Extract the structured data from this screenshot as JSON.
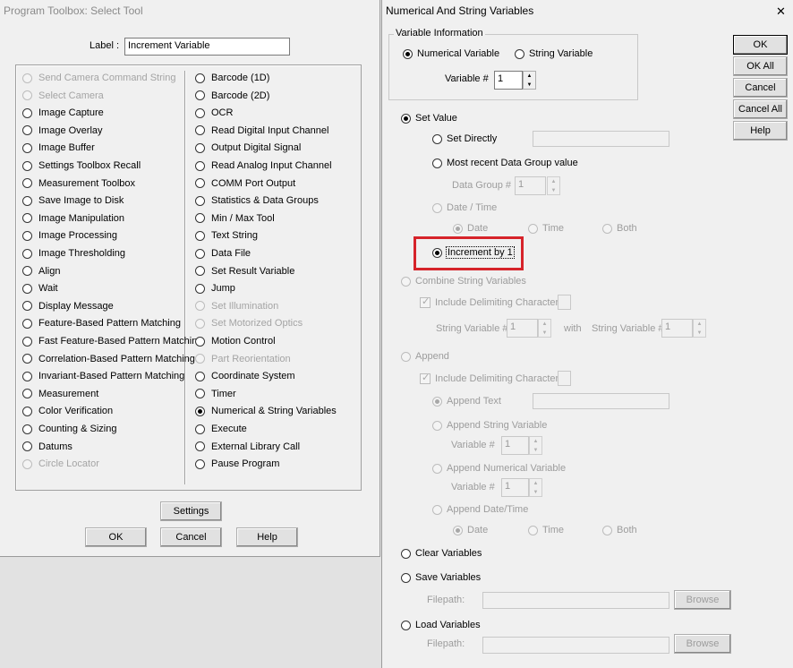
{
  "left_window": {
    "title": "Program Toolbox: Select Tool",
    "label_caption": "Label :",
    "label_value": "Increment Variable",
    "tools_col1": [
      {
        "label": "Send Camera Command String",
        "enabled": false,
        "selected": false
      },
      {
        "label": "Select Camera",
        "enabled": false,
        "selected": false
      },
      {
        "label": "Image Capture",
        "enabled": true,
        "selected": false
      },
      {
        "label": "Image Overlay",
        "enabled": true,
        "selected": false
      },
      {
        "label": "Image Buffer",
        "enabled": true,
        "selected": false
      },
      {
        "label": "Settings Toolbox Recall",
        "enabled": true,
        "selected": false
      },
      {
        "label": "Measurement Toolbox",
        "enabled": true,
        "selected": false
      },
      {
        "label": "Save Image to Disk",
        "enabled": true,
        "selected": false
      },
      {
        "label": "Image Manipulation",
        "enabled": true,
        "selected": false
      },
      {
        "label": "Image Processing",
        "enabled": true,
        "selected": false
      },
      {
        "label": "Image Thresholding",
        "enabled": true,
        "selected": false
      },
      {
        "label": "Align",
        "enabled": true,
        "selected": false
      },
      {
        "label": "Wait",
        "enabled": true,
        "selected": false
      },
      {
        "label": "Display Message",
        "enabled": true,
        "selected": false
      },
      {
        "label": "Feature-Based Pattern Matching",
        "enabled": true,
        "selected": false
      },
      {
        "label": "Fast Feature-Based Pattern Matching",
        "enabled": true,
        "selected": false
      },
      {
        "label": "Correlation-Based Pattern Matching",
        "enabled": true,
        "selected": false
      },
      {
        "label": "Invariant-Based Pattern Matching",
        "enabled": true,
        "selected": false
      },
      {
        "label": "Measurement",
        "enabled": true,
        "selected": false
      },
      {
        "label": "Color Verification",
        "enabled": true,
        "selected": false
      },
      {
        "label": "Counting & Sizing",
        "enabled": true,
        "selected": false
      },
      {
        "label": "Datums",
        "enabled": true,
        "selected": false
      },
      {
        "label": "Circle Locator",
        "enabled": false,
        "selected": false
      }
    ],
    "tools_col2": [
      {
        "label": "Barcode (1D)",
        "enabled": true,
        "selected": false
      },
      {
        "label": "Barcode (2D)",
        "enabled": true,
        "selected": false
      },
      {
        "label": "OCR",
        "enabled": true,
        "selected": false
      },
      {
        "label": "Read Digital Input Channel",
        "enabled": true,
        "selected": false
      },
      {
        "label": "Output Digital Signal",
        "enabled": true,
        "selected": false
      },
      {
        "label": "Read Analog Input Channel",
        "enabled": true,
        "selected": false
      },
      {
        "label": "COMM Port Output",
        "enabled": true,
        "selected": false
      },
      {
        "label": "Statistics & Data Groups",
        "enabled": true,
        "selected": false
      },
      {
        "label": "Min / Max Tool",
        "enabled": true,
        "selected": false
      },
      {
        "label": "Text String",
        "enabled": true,
        "selected": false
      },
      {
        "label": "Data File",
        "enabled": true,
        "selected": false
      },
      {
        "label": "Set Result Variable",
        "enabled": true,
        "selected": false
      },
      {
        "label": "Jump",
        "enabled": true,
        "selected": false
      },
      {
        "label": "Set Illumination",
        "enabled": false,
        "selected": false
      },
      {
        "label": "Set Motorized Optics",
        "enabled": false,
        "selected": false
      },
      {
        "label": "Motion Control",
        "enabled": true,
        "selected": false
      },
      {
        "label": "Part Reorientation",
        "enabled": false,
        "selected": false
      },
      {
        "label": "Coordinate System",
        "enabled": true,
        "selected": false
      },
      {
        "label": "Timer",
        "enabled": true,
        "selected": false
      },
      {
        "label": "Numerical & String Variables",
        "enabled": true,
        "selected": true
      },
      {
        "label": "Execute",
        "enabled": true,
        "selected": false
      },
      {
        "label": "External Library Call",
        "enabled": true,
        "selected": false
      },
      {
        "label": "Pause Program",
        "enabled": true,
        "selected": false
      }
    ],
    "settings_label": "Settings",
    "ok_label": "OK",
    "cancel_label": "Cancel",
    "help_label": "Help"
  },
  "right_window": {
    "title": "Numerical And String Variables",
    "close_glyph": "✕",
    "var_info_group": "Variable Information",
    "numerical_variable": "Numerical Variable",
    "string_variable": "String Variable",
    "variable_num_label": "Variable #",
    "variable_num_value": "1",
    "set_value": "Set Value",
    "set_directly": "Set Directly",
    "most_recent": "Most recent Data Group value",
    "data_group_label": "Data Group #",
    "data_group_value": "1",
    "date_time": "Date / Time",
    "date": "Date",
    "time": "Time",
    "both": "Both",
    "increment_by_1": "Increment by 1",
    "combine_string": "Combine String Variables",
    "include_delim": "Include Delimiting Character",
    "string_var_label": "String Variable #",
    "string_var_value_a": "1",
    "with_label": "with",
    "string_var_value_b": "1",
    "append": "Append",
    "append_include_delim": "Include Delimiting Character",
    "append_text": "Append Text",
    "append_string_variable": "Append String Variable",
    "append_sv_num_label": "Variable #",
    "append_sv_num_value": "1",
    "append_numerical_variable": "Append Numerical Variable",
    "append_nv_num_label": "Variable #",
    "append_nv_num_value": "1",
    "append_date_time": "Append Date/Time",
    "append_date": "Date",
    "append_time": "Time",
    "append_both": "Both",
    "clear_variables": "Clear Variables",
    "save_variables": "Save Variables",
    "save_filepath_label": "Filepath:",
    "save_browse": "Browse",
    "load_variables": "Load Variables",
    "load_filepath_label": "Filepath:",
    "load_browse": "Browse",
    "ok_label": "OK",
    "ok_all_label": "OK All",
    "cancel_label": "Cancel",
    "cancel_all_label": "Cancel All",
    "help_label": "Help",
    "highlight_color": "#d6232a"
  }
}
